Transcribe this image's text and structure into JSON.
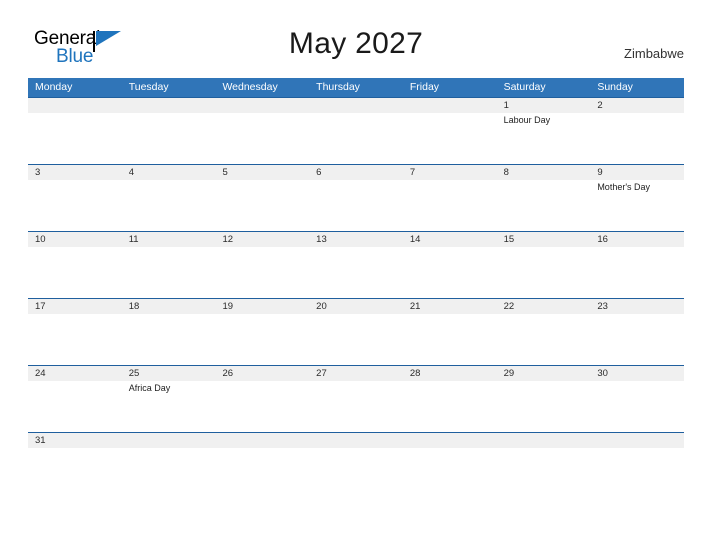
{
  "logo": {
    "word_one": "General",
    "word_two": "Blue"
  },
  "header": {
    "title": "May 2027",
    "country": "Zimbabwe"
  },
  "colors": {
    "header_blue": "#3075b8",
    "divider_blue": "#1f5f9e",
    "logo_blue": "#1f74bd",
    "date_strip_gray": "#f0f0f0"
  },
  "calendar": {
    "weekdays": [
      "Monday",
      "Tuesday",
      "Wednesday",
      "Thursday",
      "Friday",
      "Saturday",
      "Sunday"
    ],
    "weeks": [
      {
        "days": [
          {
            "date": "",
            "event": ""
          },
          {
            "date": "",
            "event": ""
          },
          {
            "date": "",
            "event": ""
          },
          {
            "date": "",
            "event": ""
          },
          {
            "date": "",
            "event": ""
          },
          {
            "date": "1",
            "event": "Labour Day"
          },
          {
            "date": "2",
            "event": ""
          }
        ]
      },
      {
        "days": [
          {
            "date": "3",
            "event": ""
          },
          {
            "date": "4",
            "event": ""
          },
          {
            "date": "5",
            "event": ""
          },
          {
            "date": "6",
            "event": ""
          },
          {
            "date": "7",
            "event": ""
          },
          {
            "date": "8",
            "event": ""
          },
          {
            "date": "9",
            "event": "Mother's Day"
          }
        ]
      },
      {
        "days": [
          {
            "date": "10",
            "event": ""
          },
          {
            "date": "11",
            "event": ""
          },
          {
            "date": "12",
            "event": ""
          },
          {
            "date": "13",
            "event": ""
          },
          {
            "date": "14",
            "event": ""
          },
          {
            "date": "15",
            "event": ""
          },
          {
            "date": "16",
            "event": ""
          }
        ]
      },
      {
        "days": [
          {
            "date": "17",
            "event": ""
          },
          {
            "date": "18",
            "event": ""
          },
          {
            "date": "19",
            "event": ""
          },
          {
            "date": "20",
            "event": ""
          },
          {
            "date": "21",
            "event": ""
          },
          {
            "date": "22",
            "event": ""
          },
          {
            "date": "23",
            "event": ""
          }
        ]
      },
      {
        "days": [
          {
            "date": "24",
            "event": ""
          },
          {
            "date": "25",
            "event": "Africa Day"
          },
          {
            "date": "26",
            "event": ""
          },
          {
            "date": "27",
            "event": ""
          },
          {
            "date": "28",
            "event": ""
          },
          {
            "date": "29",
            "event": ""
          },
          {
            "date": "30",
            "event": ""
          }
        ]
      },
      {
        "short": true,
        "days": [
          {
            "date": "31",
            "event": ""
          },
          {
            "date": "",
            "event": ""
          },
          {
            "date": "",
            "event": ""
          },
          {
            "date": "",
            "event": ""
          },
          {
            "date": "",
            "event": ""
          },
          {
            "date": "",
            "event": ""
          },
          {
            "date": "",
            "event": ""
          }
        ]
      }
    ]
  }
}
